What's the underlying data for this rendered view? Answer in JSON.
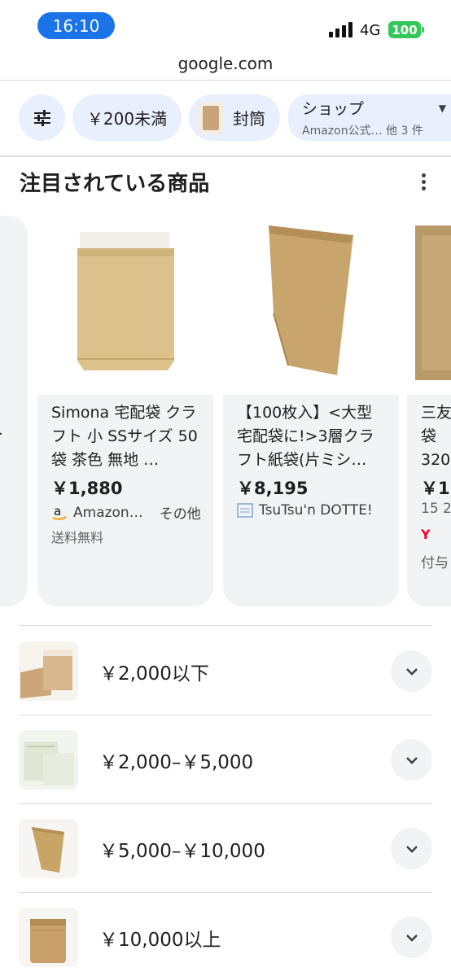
{
  "status_bar": {
    "time": "16:10",
    "network": "4G",
    "battery": "100"
  },
  "browser": {
    "url": "google.com"
  },
  "chips": {
    "price": "￥200未満",
    "envelope": "封筒",
    "shop_title": "ショップ",
    "shop_sub": "Amazon公式… 他 3 件"
  },
  "section": {
    "title": "注目されている商品"
  },
  "products": [
    {
      "title": "Simona 宅配袋 クラフト 小 SSサイズ 50袋 茶色 無地 …",
      "price": "￥1,880",
      "store": "Amazon…",
      "store_extra": "その他",
      "shipping": "送料無料"
    },
    {
      "title": "【100枚入】<大型宅配袋に!>3層クラフト紙袋(片ミシ…",
      "price": "￥8,195",
      "store": "TsuTsu'n DOTTE!"
    },
    {
      "title_line1": "三友",
      "title_line2": "袋",
      "title_line3": "320",
      "price": "￥1,",
      "meta": "15 2",
      "store": "Y",
      "extra": "付与"
    }
  ],
  "price_ranges": [
    {
      "label": "￥2,000以下"
    },
    {
      "label": "￥2,000–￥5,000"
    },
    {
      "label": "￥5,000–￥10,000"
    },
    {
      "label": "￥10,000以上"
    }
  ],
  "colors": {
    "accent": "#1a73e8",
    "chip_bg": "#e8f0fe",
    "card_bg": "#f1f3f4",
    "battery": "#34c759"
  }
}
